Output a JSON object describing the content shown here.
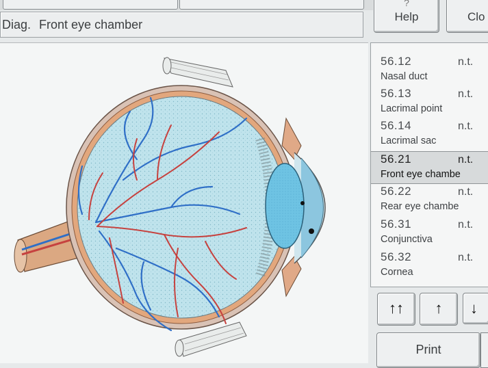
{
  "diag": {
    "label": "Diag.",
    "value": "Front eye chamber"
  },
  "toolbar": {
    "help_mark": "?",
    "help_label": "Help",
    "close_label": "Clo"
  },
  "list": {
    "items": [
      {
        "code": "56.12",
        "status": "n.t.",
        "name": "Nasal duct",
        "selected": false
      },
      {
        "code": "56.13",
        "status": "n.t.",
        "name": "Lacrimal point",
        "selected": false
      },
      {
        "code": "56.14",
        "status": "n.t.",
        "name": "Lacrimal sac",
        "selected": false
      },
      {
        "code": "56.21",
        "status": "n.t.",
        "name": "Front eye chambe",
        "selected": true
      },
      {
        "code": "56.22",
        "status": "n.t.",
        "name": "Rear eye chambe",
        "selected": false
      },
      {
        "code": "56.31",
        "status": "n.t.",
        "name": "Conjunctiva",
        "selected": false
      },
      {
        "code": "56.32",
        "status": "n.t.",
        "name": "Cornea",
        "selected": false
      }
    ]
  },
  "nav": {
    "first": "↑↑",
    "up": "↑",
    "down": "↓"
  },
  "print_label": "Print",
  "colors": {
    "panel": "#f4f6f6",
    "vitreous": "#bfe3ec",
    "lens": "#6ec3e3",
    "vein": "#2f6fc7",
    "artery": "#c6423f",
    "sclera": "#d9c2b5"
  }
}
